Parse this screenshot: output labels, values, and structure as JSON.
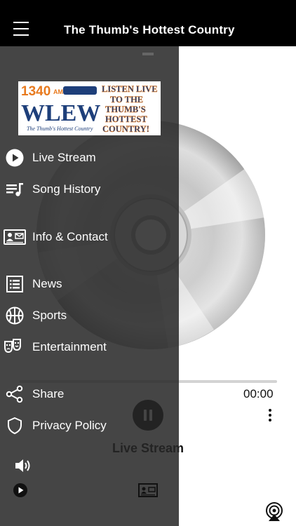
{
  "header": {
    "title": "The Thumb's Hottest Country"
  },
  "logo": {
    "frequency": "1340",
    "band": "AM",
    "call_letters": "WLEW",
    "slogan": "The Thumb's Hottest Country",
    "tagline": "LISTEN LIVE TO THE THUMB'S HOTTEST COUNTRY!"
  },
  "menu": {
    "items": [
      {
        "label": "Live Stream",
        "icon": "play-circle-icon"
      },
      {
        "label": "Song History",
        "icon": "music-list-icon"
      },
      {
        "label": "Info & Contact",
        "icon": "contact-card-icon"
      },
      {
        "label": "News",
        "icon": "news-list-icon"
      },
      {
        "label": "Sports",
        "icon": "basketball-icon"
      },
      {
        "label": "Entertainment",
        "icon": "theater-masks-icon"
      },
      {
        "label": "Share",
        "icon": "share-icon"
      },
      {
        "label": "Privacy Policy",
        "icon": "shield-icon"
      }
    ]
  },
  "player": {
    "elapsed_time": "00:00",
    "station_label": "Live Stream",
    "progress": 0
  },
  "colors": {
    "header_bg": "#000000",
    "drawer_bg": "#262626",
    "drawer_text": "#ffffff",
    "accent_text": "#111111"
  }
}
